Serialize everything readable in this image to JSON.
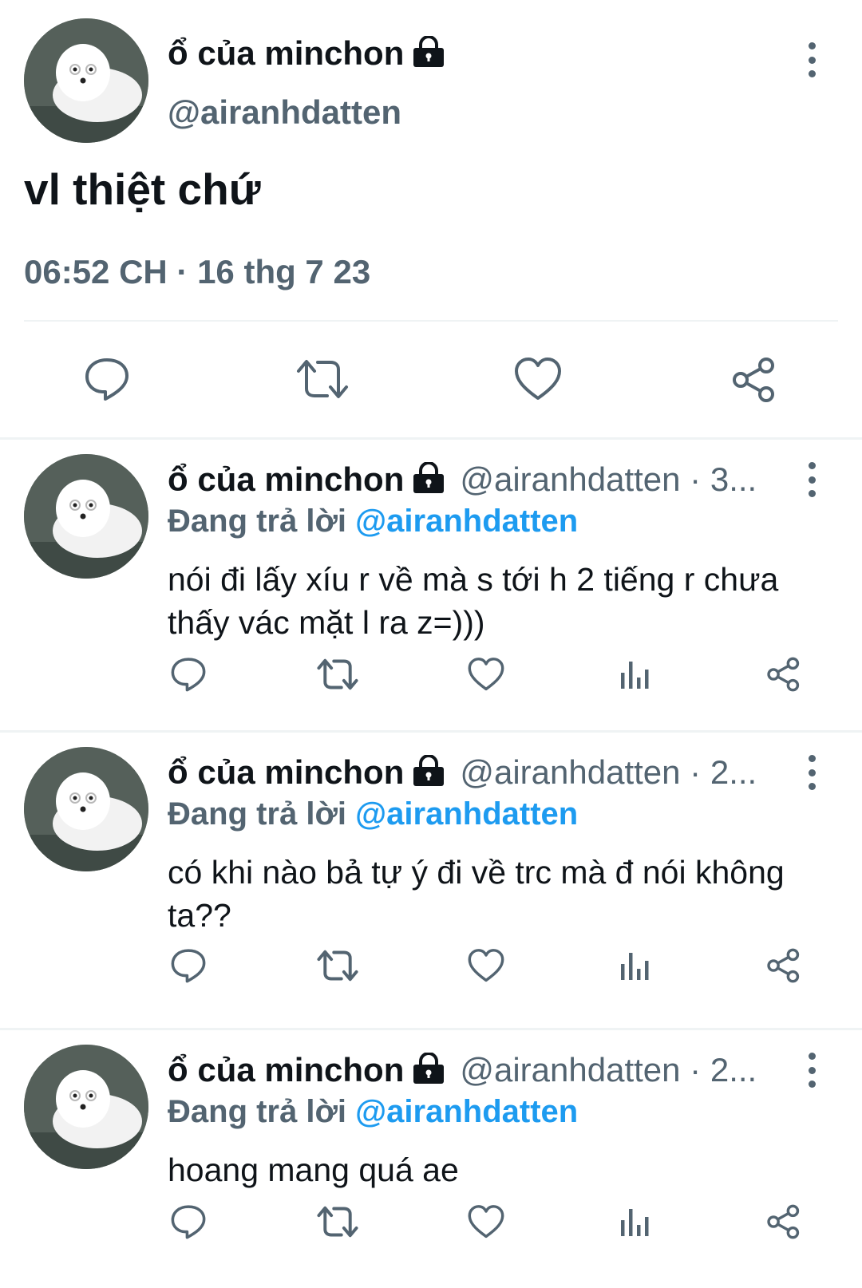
{
  "main_tweet": {
    "display_name": "ổ của minchon",
    "handle": "@airanhdatten",
    "text": "vl thiệt chứ",
    "timestamp": "06:52 CH · 16 thg 7 23"
  },
  "replies": [
    {
      "display_name": "ổ của minchon",
      "handle_time": "@airanhdatten · 3...",
      "replying_prefix": "Đang trả lời",
      "replying_to": "@airanhdatten",
      "text": "nói đi lấy xíu r về mà s tới h 2 tiếng r chưa thấy vác mặt l ra z=)))"
    },
    {
      "display_name": "ổ của minchon",
      "handle_time": "@airanhdatten · 2...",
      "replying_prefix": "Đang trả lời",
      "replying_to": "@airanhdatten",
      "text": "có khi nào bả tự ý đi về trc mà đ nói không ta??"
    },
    {
      "display_name": "ổ của minchon",
      "handle_time": "@airanhdatten · 2...",
      "replying_prefix": "Đang trả lời",
      "replying_to": "@airanhdatten",
      "text": "hoang mang quá ae"
    }
  ],
  "icons": {
    "lock": "lock-icon",
    "more": "more-vertical-icon",
    "reply": "reply-bubble-icon",
    "retweet": "retweet-icon",
    "like": "heart-icon",
    "views": "views-chart-icon",
    "share": "share-icon"
  },
  "colors": {
    "text": "#0f1419",
    "secondary": "#536471",
    "accent": "#1d9bf0",
    "divider": "#eff3f4"
  }
}
